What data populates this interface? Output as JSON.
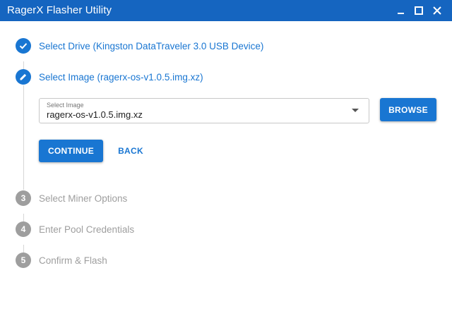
{
  "window": {
    "title": "RagerX Flasher Utility",
    "controls": {
      "minimize": "minimize-icon",
      "maximize": "maximize-icon",
      "close": "close-icon"
    }
  },
  "colors": {
    "titlebar": "#1565c0",
    "accent": "#1976d2",
    "inactive": "#9e9e9e"
  },
  "steps": [
    {
      "number": "1",
      "label": "Select Drive (Kingston DataTraveler 3.0 USB Device)",
      "state": "completed",
      "icon": "check-icon"
    },
    {
      "number": "2",
      "label": "Select Image (ragerx-os-v1.0.5.img.xz)",
      "state": "active",
      "icon": "pencil-icon"
    },
    {
      "number": "3",
      "label": "Select Miner Options",
      "state": "inactive"
    },
    {
      "number": "4",
      "label": "Enter Pool Credentials",
      "state": "inactive"
    },
    {
      "number": "5",
      "label": "Confirm & Flash",
      "state": "inactive"
    }
  ],
  "image_select": {
    "label": "Select Image",
    "value": "ragerx-os-v1.0.5.img.xz"
  },
  "buttons": {
    "browse": "BROWSE",
    "continue": "CONTINUE",
    "back": "BACK"
  }
}
